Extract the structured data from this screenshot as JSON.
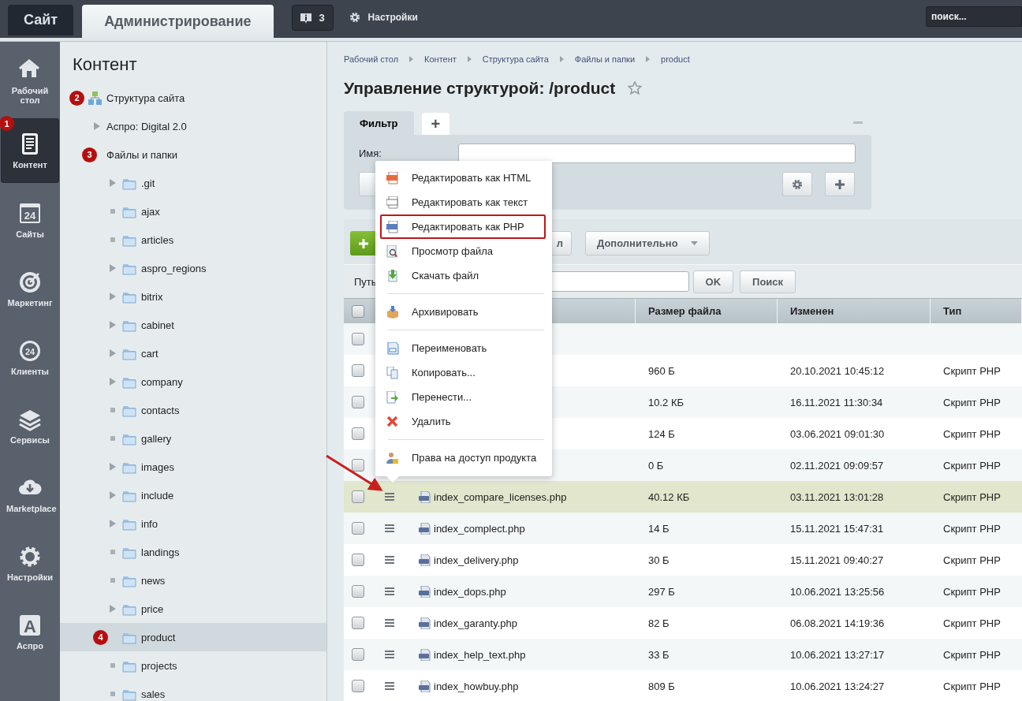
{
  "topbar": {
    "tabs": [
      {
        "label": "Сайт",
        "selected": false
      },
      {
        "label": "Администрирование",
        "selected": true
      }
    ],
    "notifications": "3",
    "settings": "Настройки",
    "search": {
      "placeholder": "поиск..."
    }
  },
  "rail": [
    {
      "label": "Рабочий стол",
      "selected": false
    },
    {
      "label": "Контент",
      "selected": true,
      "marker": "1"
    },
    {
      "label": "Сайты",
      "selected": false,
      "glyph": "24"
    },
    {
      "label": "Маркетинг",
      "selected": false
    },
    {
      "label": "Клиенты",
      "selected": false,
      "glyph": "24"
    },
    {
      "label": "Сервисы",
      "selected": false
    },
    {
      "label": "Marketplace",
      "selected": false
    },
    {
      "label": "Настройки",
      "selected": false
    },
    {
      "label": "Аспро",
      "selected": false,
      "glyph": "A"
    }
  ],
  "panel": {
    "title": "Контент",
    "tree": [
      {
        "label": "Структура сайта",
        "kind": "structure",
        "selected": false,
        "marker": "2",
        "children": [
          {
            "label": "Аспро: Digital 2.0",
            "kind": "site",
            "selected": false
          },
          {
            "label": "Файлы и папки",
            "kind": "files",
            "selected": false,
            "marker": "3",
            "children": [
              {
                "label": ".git",
                "kind": "branch",
                "selected": false
              },
              {
                "label": "ajax",
                "kind": "leaf",
                "selected": false
              },
              {
                "label": "articles",
                "kind": "leaf",
                "selected": false
              },
              {
                "label": "aspro_regions",
                "kind": "branch",
                "selected": false
              },
              {
                "label": "bitrix",
                "kind": "branch",
                "selected": false
              },
              {
                "label": "cabinet",
                "kind": "branch",
                "selected": false
              },
              {
                "label": "cart",
                "kind": "branch",
                "selected": false
              },
              {
                "label": "company",
                "kind": "branch",
                "selected": false
              },
              {
                "label": "contacts",
                "kind": "leaf",
                "selected": false
              },
              {
                "label": "gallery",
                "kind": "leaf",
                "selected": false
              },
              {
                "label": "images",
                "kind": "branch",
                "selected": false
              },
              {
                "label": "include",
                "kind": "branch",
                "selected": false
              },
              {
                "label": "info",
                "kind": "branch",
                "selected": false
              },
              {
                "label": "landings",
                "kind": "leaf",
                "selected": false
              },
              {
                "label": "news",
                "kind": "leaf",
                "selected": false
              },
              {
                "label": "price",
                "kind": "branch",
                "selected": false
              },
              {
                "label": "product",
                "kind": "leaf",
                "selected": true,
                "marker": "4"
              },
              {
                "label": "projects",
                "kind": "leaf",
                "selected": false
              },
              {
                "label": "sales",
                "kind": "leaf",
                "selected": false
              }
            ]
          }
        ]
      }
    ]
  },
  "breadcrumbs": [
    "Рабочий стол",
    "Контент",
    "Структура сайта",
    "Файлы и папки",
    "product"
  ],
  "title": "Управление структурой: /product",
  "starred": false,
  "filter": {
    "tabs": [
      {
        "label": "Фильтр",
        "selected": true
      },
      {
        "label": "+",
        "selected": false
      }
    ],
    "field_label": "Имя:"
  },
  "toolbar": {
    "buttons": [
      {
        "kind": "add"
      },
      {
        "kind": "plain",
        "label": "л"
      },
      {
        "kind": "dropdown",
        "label": "Дополнительно"
      }
    ]
  },
  "path": {
    "label": "Путь",
    "ok": "OK",
    "search": "Поиск"
  },
  "table": {
    "select_all": false,
    "columns": [
      {
        "kind": "check"
      },
      {
        "kind": "menu"
      },
      {
        "kind": "name"
      },
      {
        "kind": "text",
        "label": "Размер файла"
      },
      {
        "kind": "text",
        "label": "Изменен"
      },
      {
        "kind": "text",
        "label": "Тип"
      }
    ],
    "rows": [
      {
        "checked": false,
        "selected": false
      },
      {
        "checked": false,
        "selected": false,
        "size": "960 Б",
        "modified": "20.10.2021 10:45:12",
        "type": "Скрипт PHP"
      },
      {
        "checked": false,
        "selected": false,
        "size": "10.2 КБ",
        "modified": "16.11.2021 11:30:34",
        "type": "Скрипт PHP"
      },
      {
        "checked": false,
        "selected": false,
        "size": "124 Б",
        "modified": "03.06.2021 09:01:30",
        "type": "Скрипт PHP"
      },
      {
        "checked": false,
        "selected": false,
        "size": "0 Б",
        "modified": "02.11.2021 09:09:57",
        "type": "Скрипт PHP"
      },
      {
        "checked": false,
        "selected": true,
        "name": "index_compare_licenses.php",
        "size": "40.12 КБ",
        "modified": "03.11.2021 13:01:28",
        "type": "Скрипт PHP"
      },
      {
        "checked": false,
        "selected": false,
        "name": "index_complect.php",
        "size": "14 Б",
        "modified": "15.11.2021 15:47:31",
        "type": "Скрипт PHP"
      },
      {
        "checked": false,
        "selected": false,
        "name": "index_delivery.php",
        "size": "30 Б",
        "modified": "15.11.2021 09:40:27",
        "type": "Скрипт PHP"
      },
      {
        "checked": false,
        "selected": false,
        "name": "index_dops.php",
        "size": "297 Б",
        "modified": "10.06.2021 13:25:56",
        "type": "Скрипт PHP"
      },
      {
        "checked": false,
        "selected": false,
        "name": "index_garanty.php",
        "size": "82 Б",
        "modified": "06.08.2021 14:19:36",
        "type": "Скрипт PHP"
      },
      {
        "checked": false,
        "selected": false,
        "name": "index_help_text.php",
        "size": "33 Б",
        "modified": "10.06.2021 13:27:17",
        "type": "Скрипт PHP"
      },
      {
        "checked": false,
        "selected": false,
        "name": "index_howbuy.php",
        "size": "809 Б",
        "modified": "10.06.2021 13:24:27",
        "type": "Скрипт PHP"
      }
    ]
  },
  "context_menu": {
    "items": [
      {
        "kind": "item",
        "label": "Редактировать как HTML",
        "outlined": false
      },
      {
        "kind": "item",
        "label": "Редактировать как текст",
        "outlined": false
      },
      {
        "kind": "item",
        "label": "Редактировать как PHP",
        "outlined": true
      },
      {
        "kind": "item",
        "label": "Просмотр файла",
        "outlined": false
      },
      {
        "kind": "item",
        "label": "Скачать файл",
        "outlined": false
      },
      {
        "kind": "separator"
      },
      {
        "kind": "item",
        "label": "Архивировать",
        "outlined": false
      },
      {
        "kind": "separator"
      },
      {
        "kind": "item",
        "label": "Переименовать",
        "outlined": false
      },
      {
        "kind": "item",
        "label": "Копировать...",
        "outlined": false
      },
      {
        "kind": "item",
        "label": "Перенести...",
        "outlined": false
      },
      {
        "kind": "item",
        "label": "Удалить",
        "outlined": false
      },
      {
        "kind": "separator"
      },
      {
        "kind": "item",
        "label": "Права на доступ продукта",
        "outlined": false
      }
    ]
  }
}
